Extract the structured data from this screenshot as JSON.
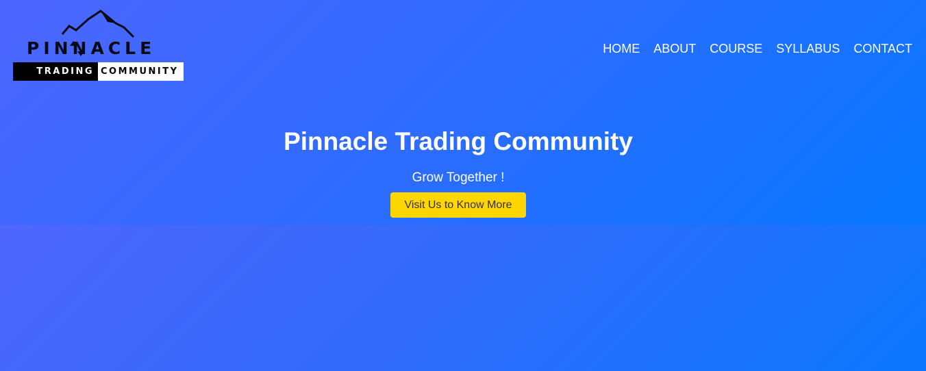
{
  "brand": {
    "name": "PINNACLE",
    "tagline_left": "TRADING",
    "tagline_right": "COMMUNITY"
  },
  "nav": {
    "items": [
      "HOME",
      "ABOUT",
      "COURSE",
      "SYLLABUS",
      "CONTACT"
    ]
  },
  "hero": {
    "title": "Pinnacle Trading Community",
    "subtitle": "Grow Together !",
    "cta_label": "Visit Us to Know More"
  },
  "colors": {
    "accent": "#ffd600",
    "background_start": "#4d66ff",
    "background_end": "#0677ff"
  },
  "icons": {
    "logo_mark": "mountain-peak-icon",
    "logo_arrows": "up-down-arrows-icon"
  }
}
